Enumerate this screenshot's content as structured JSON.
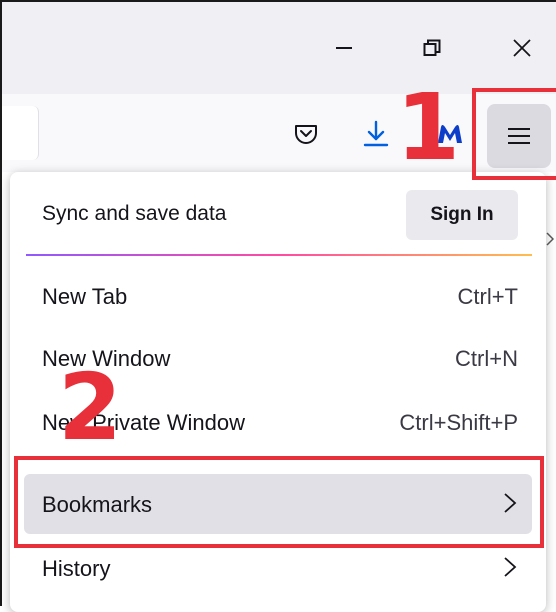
{
  "window_controls": {
    "minimize_icon": "minimize-icon",
    "restore_icon": "restore-icon",
    "close_icon": "close-icon"
  },
  "toolbar": {
    "pocket_icon": "pocket-icon",
    "downloads_icon": "download-icon",
    "extension_icon": "malwarebytes-icon",
    "menu_icon": "hamburger-menu-icon"
  },
  "annotations": {
    "step1": "1",
    "step2": "2",
    "color": "#e8303a"
  },
  "menu": {
    "sync_label": "Sync and save data",
    "sign_in_label": "Sign In",
    "items": [
      {
        "label": "New Tab",
        "shortcut": "Ctrl+T"
      },
      {
        "label": "New Window",
        "shortcut": "Ctrl+N"
      },
      {
        "label": "New Private Window",
        "shortcut": "Ctrl+Shift+P"
      },
      {
        "label": "Bookmarks",
        "shortcut": ""
      },
      {
        "label": "History",
        "shortcut": ""
      }
    ]
  },
  "colors": {
    "accent_blue": "#0060df",
    "annotation_red": "#e8303a",
    "menu_highlight": "#e0e0e6"
  }
}
